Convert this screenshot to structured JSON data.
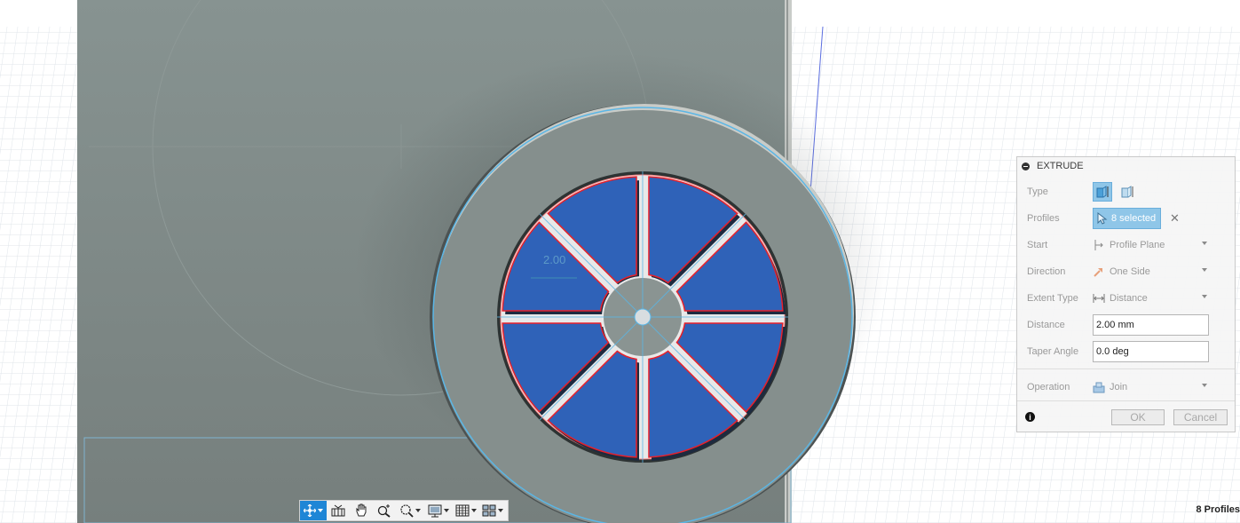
{
  "dialog": {
    "title": "EXTRUDE",
    "rows": {
      "type": {
        "label": "Type"
      },
      "profiles": {
        "label": "Profiles",
        "value": "8 selected"
      },
      "start": {
        "label": "Start",
        "value": "Profile Plane"
      },
      "direction": {
        "label": "Direction",
        "value": "One Side"
      },
      "extent_type": {
        "label": "Extent Type",
        "value": "Distance"
      },
      "distance": {
        "label": "Distance",
        "value": "2.00 mm"
      },
      "taper_angle": {
        "label": "Taper Angle",
        "value": "0.0 deg"
      },
      "operation": {
        "label": "Operation",
        "value": "Join"
      }
    },
    "ok_label": "OK",
    "cancel_label": "Cancel",
    "info_symbol": "i",
    "close_symbol": "✕"
  },
  "canvas": {
    "dimension_label": "2.00",
    "profile_count": 8,
    "colors": {
      "grid_line": "#d9dfe6",
      "body_gray": "#7f8a88",
      "profile_blue": "#2f62b8",
      "profile_outline": "#e8202a",
      "sketch_line": "#5ab6e6"
    }
  },
  "toolbar": {
    "buttons": [
      {
        "name": "orbit",
        "icon": "orbit-icon",
        "active": true
      },
      {
        "name": "look-at",
        "icon": "look-at-icon"
      },
      {
        "name": "pan",
        "icon": "pan-hand-icon"
      },
      {
        "name": "zoom",
        "icon": "zoom-icon"
      },
      {
        "name": "fit",
        "icon": "zoom-window-icon"
      },
      {
        "name": "display-settings",
        "icon": "display-settings-icon"
      },
      {
        "name": "grid-settings",
        "icon": "grid-icon"
      },
      {
        "name": "viewports",
        "icon": "viewports-icon"
      }
    ]
  },
  "status": {
    "text": "8 Profiles"
  }
}
